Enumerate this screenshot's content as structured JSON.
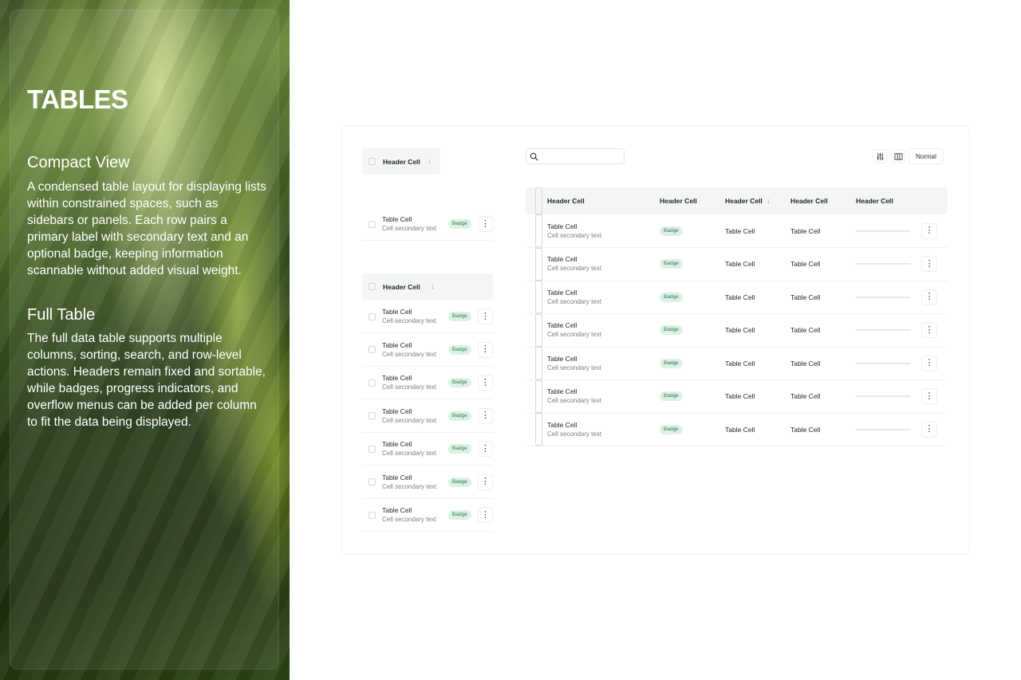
{
  "hero": {
    "title": "TABLES",
    "sections": [
      {
        "heading": "Compact View",
        "body": "A condensed table layout for displaying lists within constrained spaces, such as sidebars or panels. Each row pairs a primary label with secondary text and an optional badge, keeping information scannable without added visual weight."
      },
      {
        "heading": "Full Table",
        "body": "The full data table supports multiple columns, sorting, search, and row-level actions. Headers remain fixed and sortable, while badges, progress indicators, and overflow menus can be added per column to fit the data being displayed."
      }
    ]
  },
  "compact_single": {
    "header": "Header Cell",
    "row": {
      "title": "Table Cell",
      "subtitle": "Cell secondary text",
      "badge": "Badge"
    }
  },
  "compact_list": {
    "header": "Header Cell",
    "rows": [
      {
        "title": "Table Cell",
        "subtitle": "Cell secondary text",
        "badge": "Badge"
      },
      {
        "title": "Table Cell",
        "subtitle": "Cell secondary text",
        "badge": "Badge"
      },
      {
        "title": "Table Cell",
        "subtitle": "Cell secondary text",
        "badge": "Badge"
      },
      {
        "title": "Table Cell",
        "subtitle": "Cell secondary text",
        "badge": "Badge"
      },
      {
        "title": "Table Cell",
        "subtitle": "Cell secondary text",
        "badge": "Badge"
      },
      {
        "title": "Table Cell",
        "subtitle": "Cell secondary text",
        "badge": "Badge"
      },
      {
        "title": "Table Cell",
        "subtitle": "Cell secondary text",
        "badge": "Badge"
      }
    ]
  },
  "full_table": {
    "search": {
      "placeholder": "",
      "icon": "search-icon"
    },
    "toolbar": {
      "filter_icon": "sliders-icon",
      "columns_icon": "columns-icon",
      "density": "Normal"
    },
    "headers": [
      "Header Cell",
      "Header Cell",
      "Header Cell",
      "Header Cell",
      "Header Cell"
    ],
    "sorted_column_index": 2,
    "rows": [
      {
        "title": "Table Cell",
        "subtitle": "Cell secondary text",
        "badge": "Badge",
        "col3": "Table Cell",
        "col4": "Table Cell",
        "progress": 0
      },
      {
        "title": "Table Cell",
        "subtitle": "Cell secondary text",
        "badge": "Badge",
        "col3": "Table Cell",
        "col4": "Table Cell",
        "progress": 0
      },
      {
        "title": "Table Cell",
        "subtitle": "Cell secondary text",
        "badge": "Badge",
        "col3": "Table Cell",
        "col4": "Table Cell",
        "progress": 0
      },
      {
        "title": "Table Cell",
        "subtitle": "Cell secondary text",
        "badge": "Badge",
        "col3": "Table Cell",
        "col4": "Table Cell",
        "progress": 0
      },
      {
        "title": "Table Cell",
        "subtitle": "Cell secondary text",
        "badge": "Badge",
        "col3": "Table Cell",
        "col4": "Table Cell",
        "progress": 0
      },
      {
        "title": "Table Cell",
        "subtitle": "Cell secondary text",
        "badge": "Badge",
        "col3": "Table Cell",
        "col4": "Table Cell",
        "progress": 0
      },
      {
        "title": "Table Cell",
        "subtitle": "Cell secondary text",
        "badge": "Badge",
        "col3": "Table Cell",
        "col4": "Table Cell",
        "progress": 0
      }
    ]
  },
  "colors": {
    "badge_bg": "#dcf1e4",
    "badge_text": "#2f7a4d",
    "header_bg": "#f4f5f5"
  }
}
